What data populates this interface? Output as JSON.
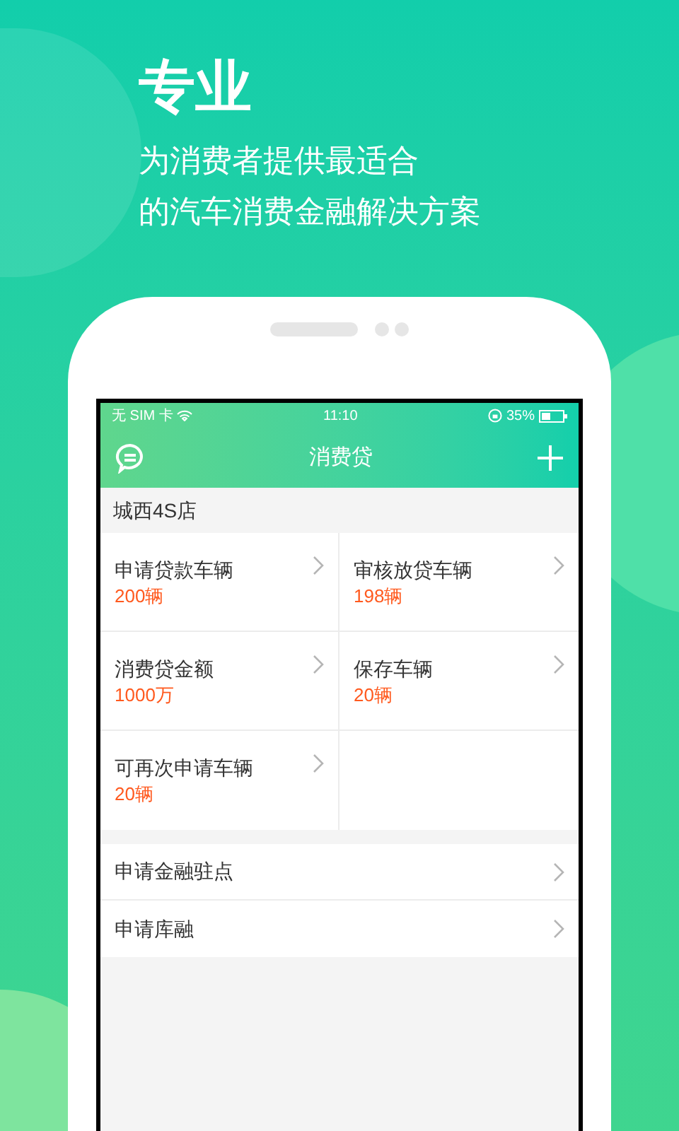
{
  "headline": "专业",
  "subtitle_lines": [
    "为消费者提供最适合",
    "的汽车消费金融解决方案"
  ],
  "status_bar": {
    "carrier": "无 SIM 卡",
    "time": "11:10",
    "battery": "35%"
  },
  "nav_bar": {
    "title": "消费贷"
  },
  "section": {
    "title": "城西4S店"
  },
  "stats": [
    {
      "label": "申请贷款车辆",
      "value": "200辆"
    },
    {
      "label": "审核放贷车辆",
      "value": "198辆"
    },
    {
      "label": "消费贷金额",
      "value": "1000万"
    },
    {
      "label": "保存车辆",
      "value": "20辆"
    },
    {
      "label": "可再次申请车辆",
      "value": "20辆"
    }
  ],
  "menu": [
    {
      "label": "申请金融驻点"
    },
    {
      "label": "申请库融"
    }
  ]
}
